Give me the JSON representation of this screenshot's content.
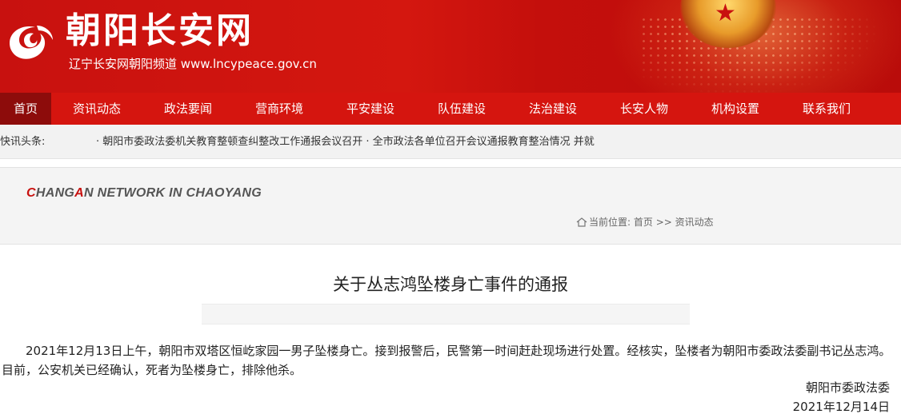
{
  "header": {
    "site_title": "朝阳长安网",
    "subtitle": "辽宁长安网朝阳频道 www.lncypeace.gov.cn",
    "logo_icon": "swirl-logo-icon",
    "colors": {
      "banner_red": "#c8110f",
      "nav_red": "#d5150f",
      "nav_active": "#8d0c0b"
    }
  },
  "nav": {
    "items": [
      "首页",
      "资讯动态",
      "政法要闻",
      "营商环境",
      "平安建设",
      "队伍建设",
      "法治建设",
      "长安人物",
      "机构设置",
      "联系我们"
    ],
    "active": "首页"
  },
  "ticker": {
    "label": "快讯头条:",
    "text": "· 朝阳市委政法委机关教育整顿查纠整改工作通报会议召开 · 全市政法各单位召开会议通报教育整治情况 并就"
  },
  "section": {
    "en_title_a": "C",
    "en_title_b": "HANG",
    "en_title_c": "A",
    "en_title_d": "N NETWORK IN CHAOYANG",
    "breadcrumb_prefix": "当前位置:",
    "breadcrumb_home": "首页",
    "breadcrumb_sep": ">>",
    "breadcrumb_current": "资讯动态",
    "home_icon": "home-icon"
  },
  "article": {
    "title": "关于丛志鸿坠楼身亡事件的通报",
    "body": "2021年12月13日上午，朝阳市双塔区恒屹家园一男子坠楼身亡。接到报警后，民警第一时间赶赴现场进行处置。经核实，坠楼者为朝阳市委政法委副书记丛志鸿。目前，公安机关已经确认，死者为坠楼身亡，排除他杀。",
    "signer": "朝阳市委政法委",
    "date": "2021年12月14日"
  }
}
